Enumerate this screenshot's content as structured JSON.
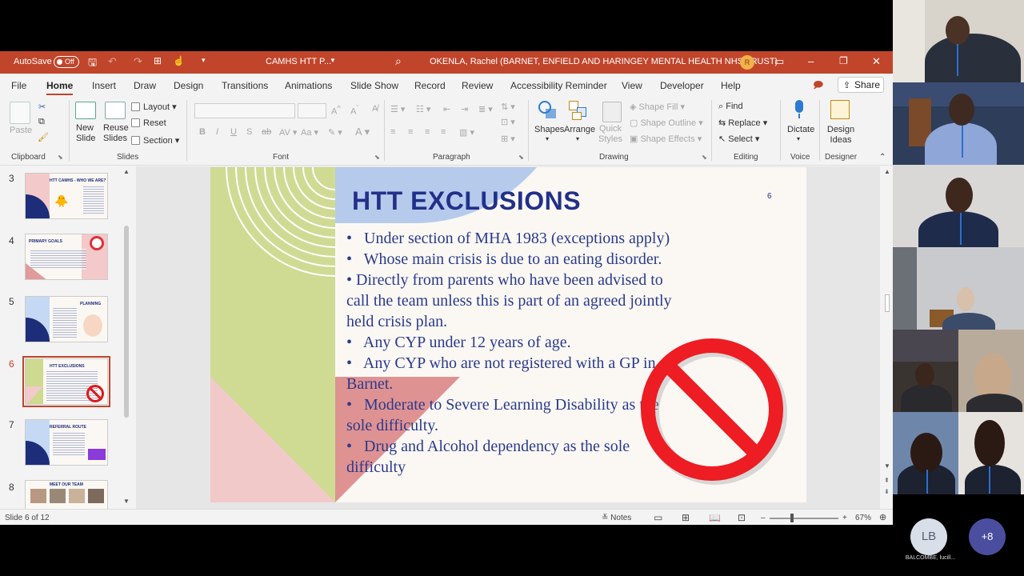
{
  "window": {
    "autosave_label": "AutoSave",
    "autosave_state": "Off",
    "doc_title": "CAMHS HTT P...",
    "user_name": "OKENLA, Rachel (BARNET, ENFIELD AND HARINGEY MENTAL HEALTH NHS TRUST)",
    "user_initial": "R",
    "accent_color": "#c0452b"
  },
  "tabs": [
    "File",
    "Home",
    "Insert",
    "Draw",
    "Design",
    "Transitions",
    "Animations",
    "Slide Show",
    "Record",
    "Review",
    "Accessibility Reminder",
    "View",
    "Developer",
    "Help"
  ],
  "share_label": "Share",
  "ribbon": {
    "clipboard": {
      "paste": "Paste",
      "label": "Clipboard"
    },
    "slides": {
      "new_slide": "New Slide",
      "reuse_slides": "Reuse Slides",
      "layout": "Layout",
      "reset": "Reset",
      "section": "Section",
      "label": "Slides"
    },
    "font": {
      "bold": "B",
      "italic": "I",
      "underline": "U",
      "strike": "S",
      "aa": "Aa",
      "label": "Font"
    },
    "paragraph": {
      "label": "Paragraph"
    },
    "drawing": {
      "shapes": "Shapes",
      "arrange": "Arrange",
      "quick_styles": "Quick Styles",
      "shape_fill": "Shape Fill",
      "shape_outline": "Shape Outline",
      "shape_effects": "Shape Effects",
      "label": "Drawing"
    },
    "editing": {
      "find": "Find",
      "replace": "Replace",
      "select": "Select",
      "label": "Editing"
    },
    "voice": {
      "dictate": "Dictate",
      "label": "Voice"
    },
    "designer": {
      "design_ideas": "Design Ideas",
      "label": "Designer"
    }
  },
  "thumbnails": [
    {
      "num": "3",
      "title": "HTT CAMHS - WHO WE ARE?"
    },
    {
      "num": "4",
      "title": "PRIMARY GOALS"
    },
    {
      "num": "5",
      "title": "PLANNING"
    },
    {
      "num": "6",
      "title": "HTT EXCLUSIONS",
      "selected": true
    },
    {
      "num": "7",
      "title": "REFERRAL ROUTE"
    },
    {
      "num": "8",
      "title": "MEET OUR TEAM"
    }
  ],
  "slide": {
    "title": "HTT EXCLUSIONS",
    "page_number": "6",
    "lines": [
      "•   Under section of MHA 1983 (exceptions apply)",
      "•   Whose main crisis is due to an eating disorder.",
      "• Directly from parents who have been advised to",
      "call the team unless this is part of an agreed jointly",
      "held crisis plan.",
      "•   Any CYP under 12 years of age.",
      "•   Any CYP who are not registered with a GP in",
      "Barnet.",
      "•   Moderate to Severe Learning Disability as the",
      "sole difficulty.",
      "•   Drug and Alcohol dependency as the sole",
      "difficulty"
    ]
  },
  "status": {
    "slide_info": "Slide 6 of 12",
    "notes": "Notes",
    "zoom": "67%"
  },
  "meeting": {
    "avatar_initials": "LB",
    "avatar_name": "BALCOMBE, lucill...",
    "more_count": "+8"
  }
}
